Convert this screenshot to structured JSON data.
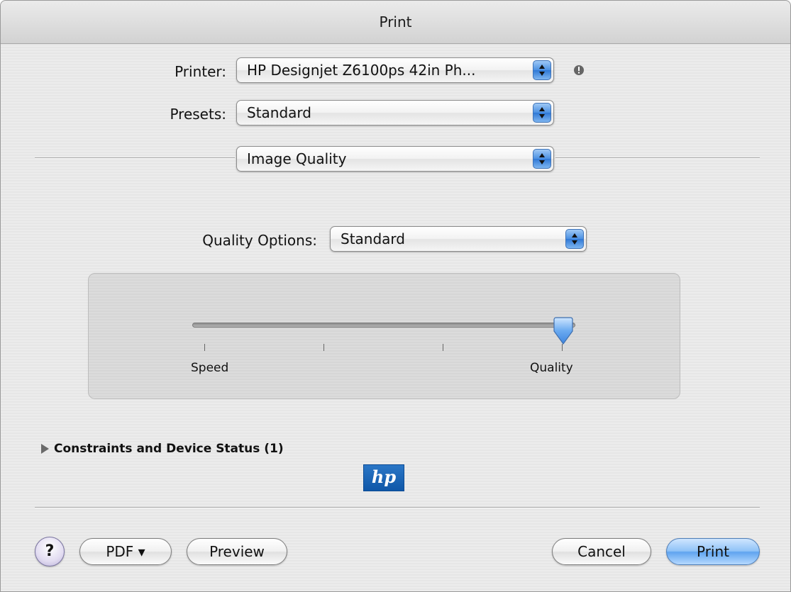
{
  "window": {
    "title": "Print"
  },
  "printer": {
    "label": "Printer:",
    "value": "HP Designjet Z6100ps 42in Ph...",
    "warning_icon": "exclamation-circle-icon"
  },
  "presets": {
    "label": "Presets:",
    "value": "Standard"
  },
  "panel": {
    "value": "Image Quality"
  },
  "quality_options": {
    "label": "Quality Options:",
    "value": "Standard"
  },
  "slider": {
    "min_label": "Speed",
    "max_label": "Quality",
    "ticks": 4,
    "position": 1.0
  },
  "constraints": {
    "label": "Constraints and Device Status (1)",
    "icon": "disclosure-triangle-right-icon"
  },
  "logo": {
    "text": "hp"
  },
  "buttons": {
    "help": "?",
    "pdf": "PDF ▾",
    "preview": "Preview",
    "cancel": "Cancel",
    "print": "Print"
  },
  "colors": {
    "accent": "#5fa4ef",
    "logo": "#1a66b8"
  }
}
